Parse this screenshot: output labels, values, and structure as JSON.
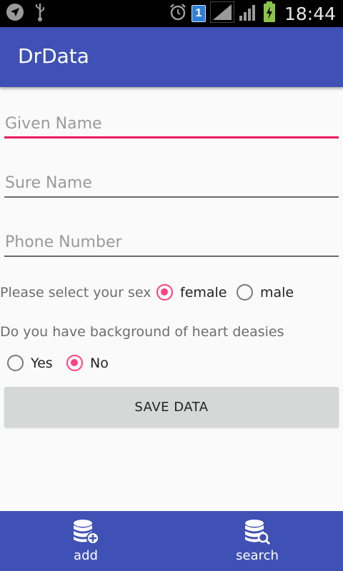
{
  "status_bar": {
    "time": "18:44",
    "sim_number": "1",
    "icons": [
      "location-arrow-icon",
      "usb-icon",
      "alarm-icon",
      "sim-icon",
      "signal-icon",
      "signal-icon",
      "battery-charging-icon"
    ]
  },
  "app_bar": {
    "title": "DrData"
  },
  "form": {
    "given_name": {
      "placeholder": "Given Name",
      "value": ""
    },
    "sure_name": {
      "placeholder": "Sure Name",
      "value": ""
    },
    "phone_number": {
      "placeholder": "Phone Number",
      "value": ""
    },
    "sex_prompt": "Please select your sex",
    "sex_options": [
      {
        "label": "female",
        "checked": true
      },
      {
        "label": "male",
        "checked": false
      }
    ],
    "heart_prompt": "Do you have background of heart deasies",
    "heart_options": [
      {
        "label": "Yes",
        "checked": false
      },
      {
        "label": "No",
        "checked": true
      }
    ],
    "save_label": "SAVE DATA"
  },
  "bottom_nav": {
    "items": [
      {
        "label": "add",
        "icon": "database-add-icon"
      },
      {
        "label": "search",
        "icon": "database-search-icon"
      }
    ]
  },
  "colors": {
    "primary": "#3f51b5",
    "accent": "#ff4081",
    "focus_underline": "#e91e63",
    "status_bar": "#000000"
  }
}
